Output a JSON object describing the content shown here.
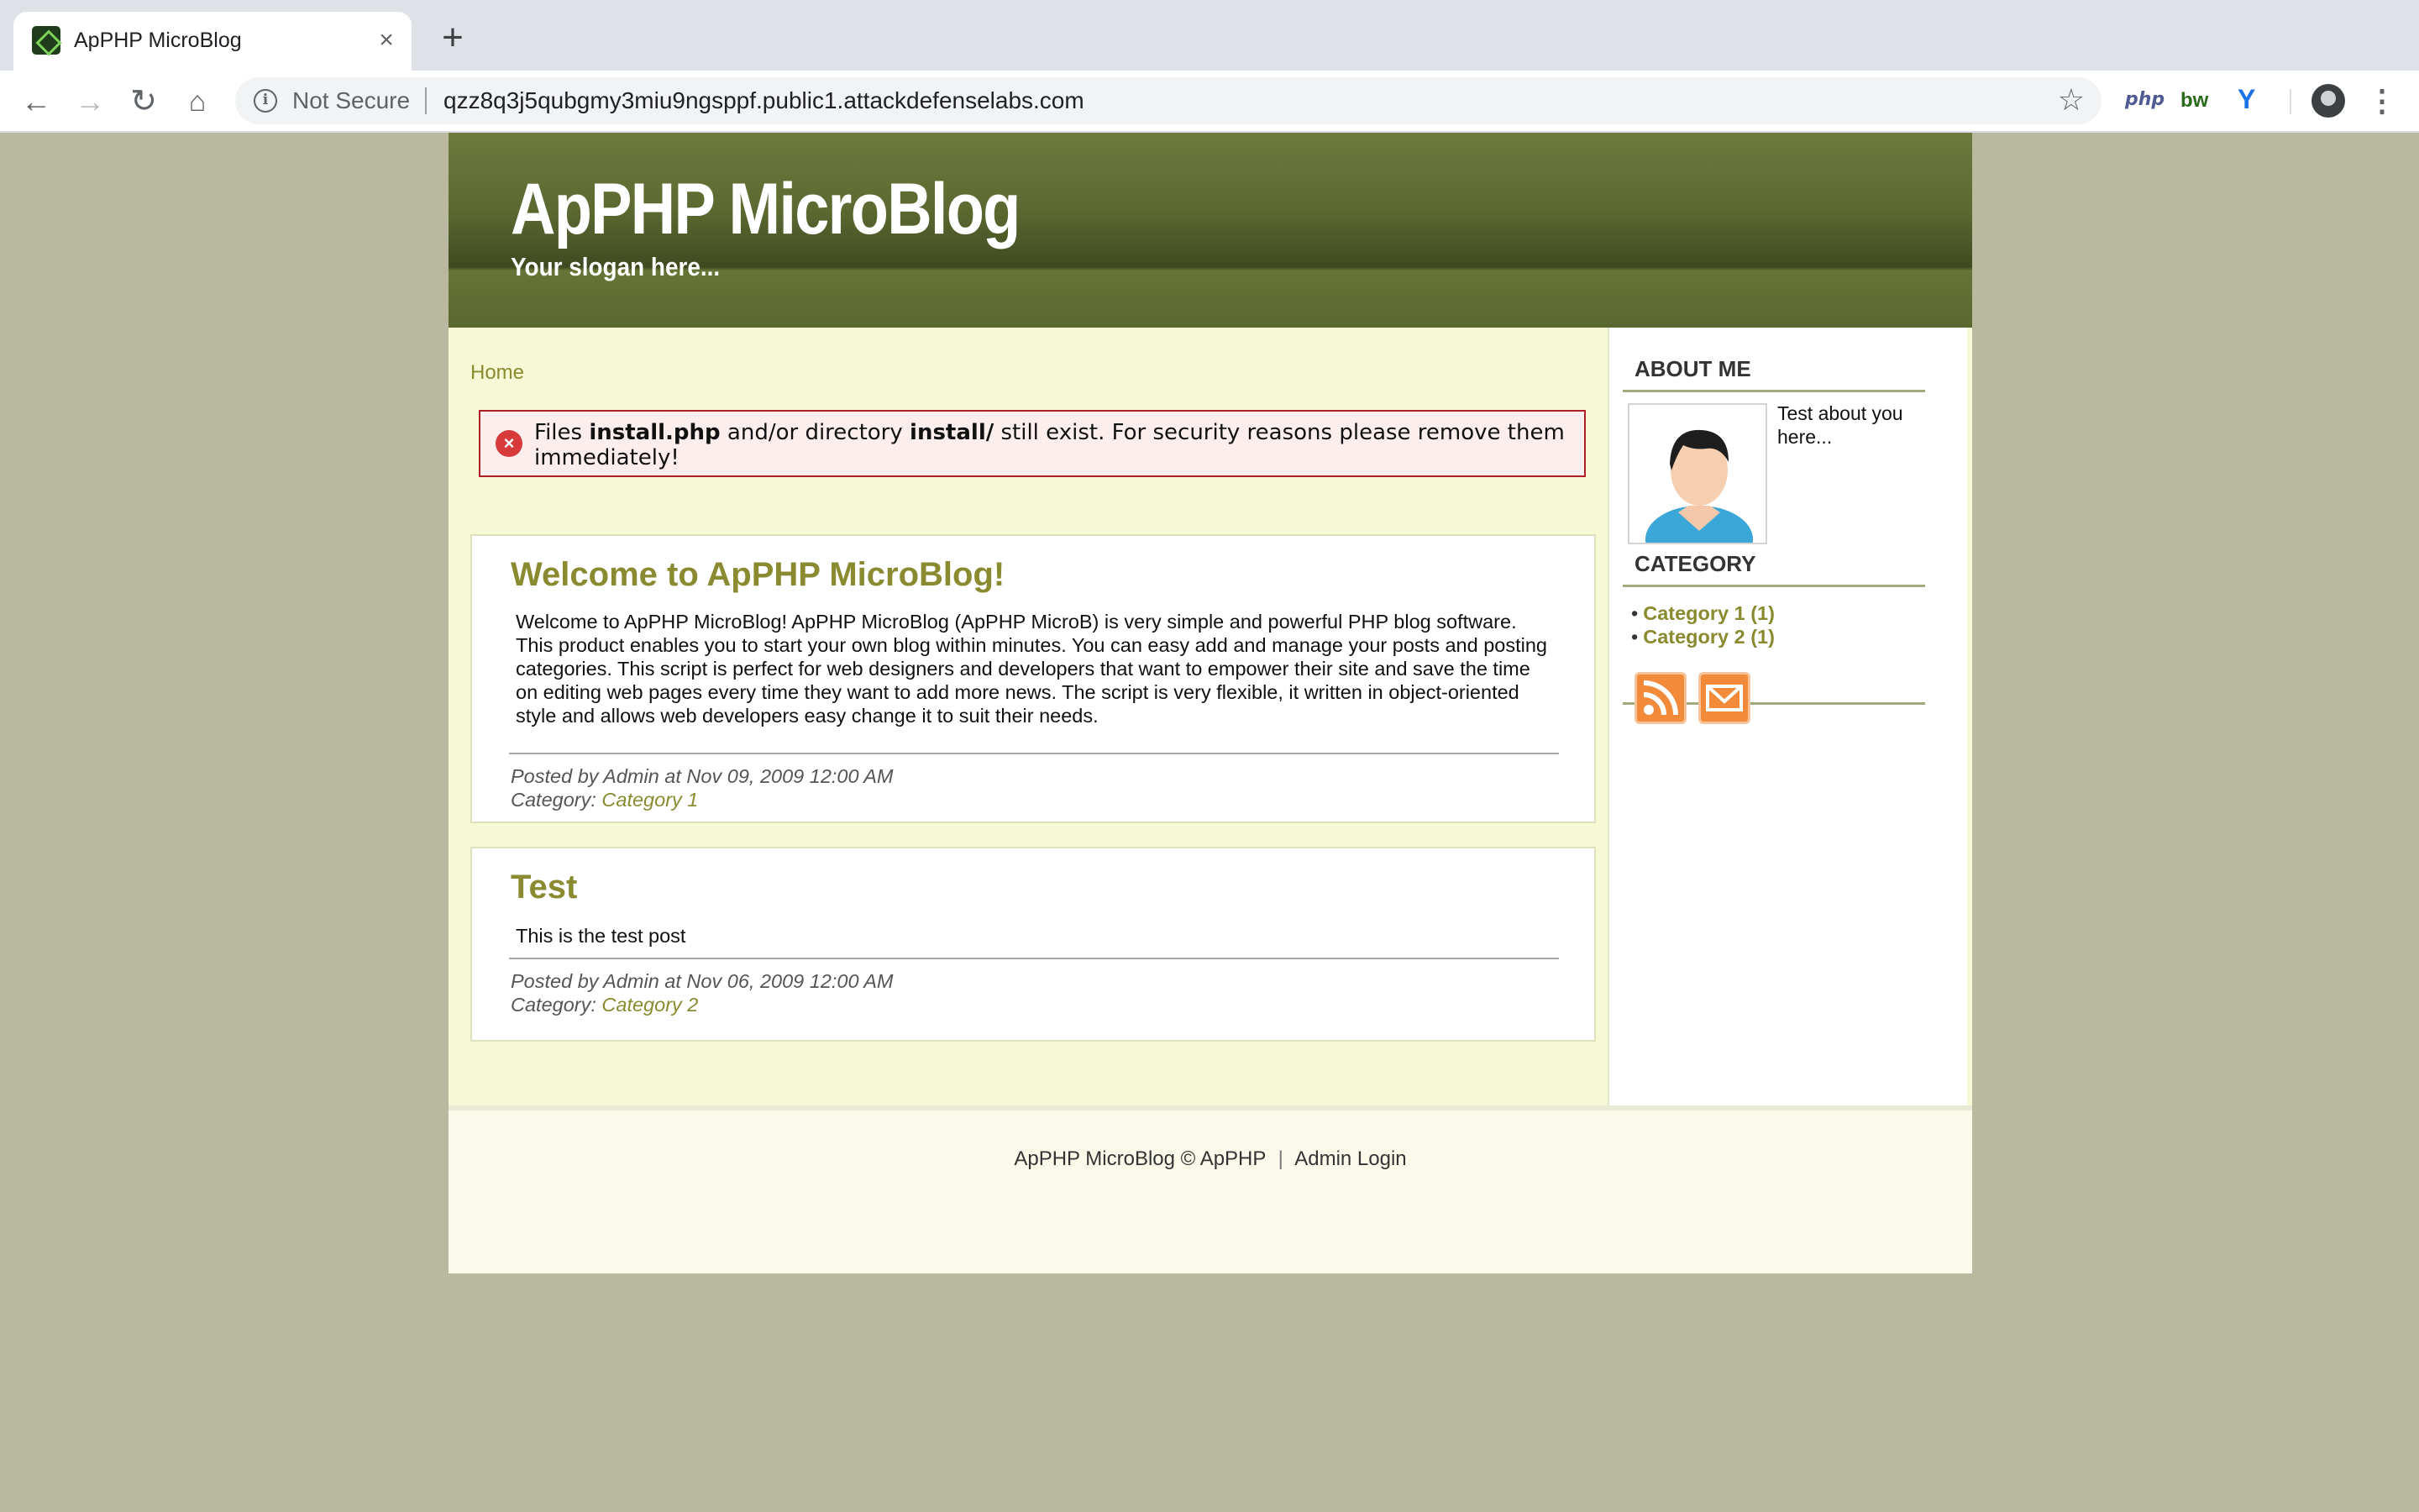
{
  "browser": {
    "tab_title": "ApPHP MicroBlog",
    "tab_close": "×",
    "new_tab": "+",
    "not_secure": "Not Secure",
    "url": "qzz8q3j5qubgmy3miu9ngsppf.public1.attackdefenselabs.com",
    "extensions": {
      "php": "php",
      "bw": "bw",
      "v": "Y"
    },
    "icons": [
      "back-arrow-icon",
      "forward-arrow-icon",
      "reload-icon",
      "home-icon",
      "info-icon",
      "star-icon",
      "profile-avatar-icon",
      "kebab-menu-icon"
    ]
  },
  "site": {
    "title": "ApPHP MicroBlog",
    "slogan": "Your slogan here..."
  },
  "breadcrumb": {
    "home": "Home"
  },
  "alert": {
    "prefix": "Files ",
    "file": "install.php",
    "middle": " and/or directory ",
    "dir": "install/",
    "suffix": " still exist. For security reasons please remove them immediately!"
  },
  "posts": [
    {
      "title": "Welcome to ApPHP MicroBlog!",
      "body": "Welcome to ApPHP MicroBlog! ApPHP MicroBlog (ApPHP MicroB) is very simple and powerful PHP blog software. This product enables you to start your own blog within minutes. You can easy add and manage your posts and posting categories. This script is perfect for web designers and developers that want to empower their site and save the time on editing web pages every time they want to add more news. The script is very flexible, it written in object-oriented style and allows web developers easy change it to suit their needs.",
      "posted": "Posted by Admin at Nov 09, 2009 12:00 AM",
      "category_label": "Category: ",
      "category": "Category 1"
    },
    {
      "title": "Test",
      "body": "This is the test post",
      "posted": "Posted by Admin at Nov 06, 2009 12:00 AM",
      "category_label": "Category: ",
      "category": "Category 2"
    }
  ],
  "sidebar": {
    "about_heading": "ABOUT ME",
    "about_text": "Test about you here...",
    "category_heading": "CATEGORY",
    "categories": [
      "Category 1 (1)",
      "Category 2 (1)"
    ],
    "bullet": "•"
  },
  "footer": {
    "copyright": "ApPHP MicroBlog © ApPHP",
    "separator": "|",
    "admin_login": "Admin Login"
  }
}
